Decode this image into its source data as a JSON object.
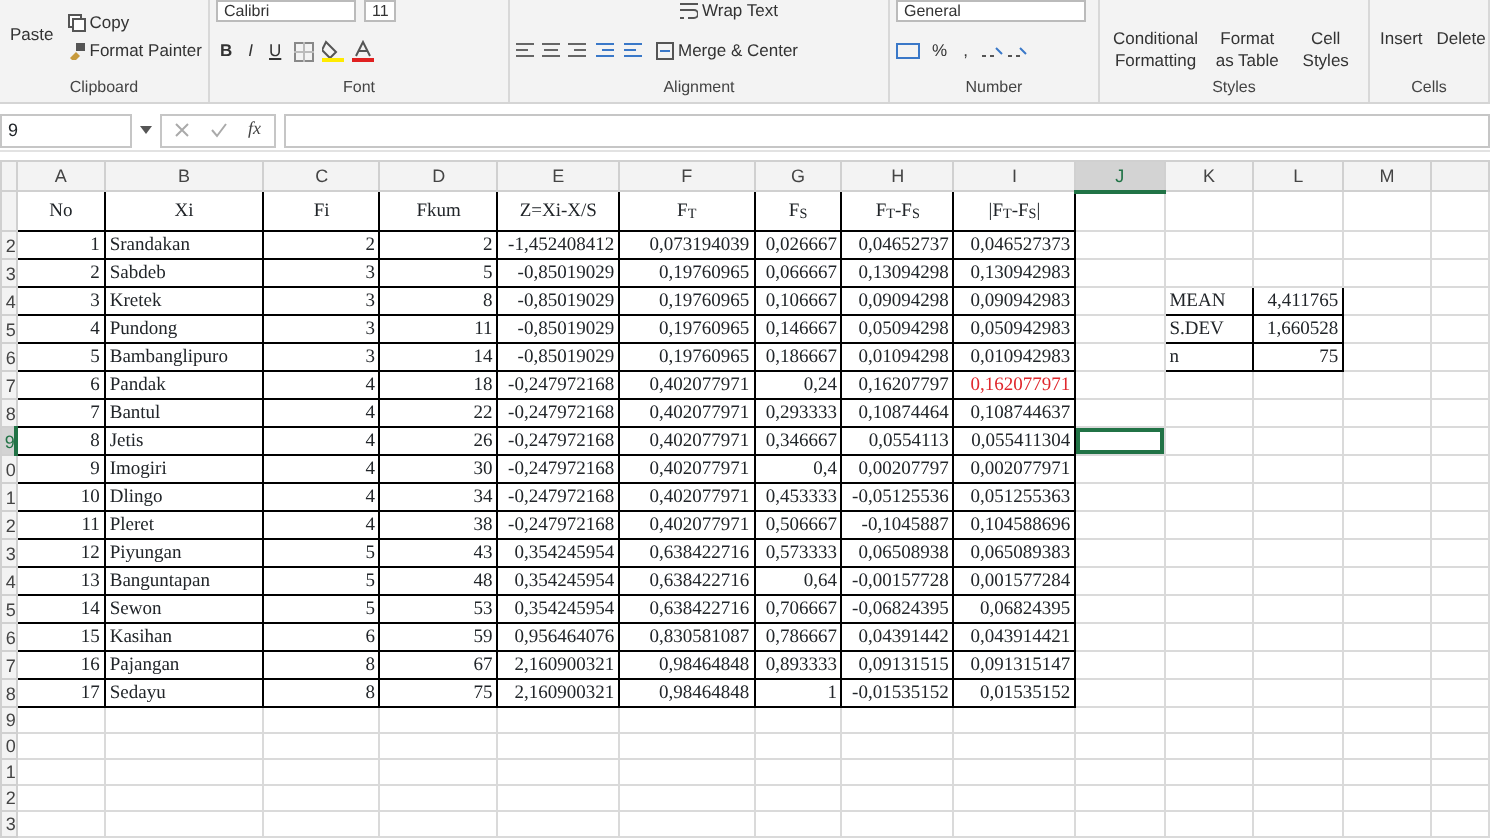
{
  "ribbon": {
    "groups": [
      {
        "label": "Clipboard",
        "kind": "clipboard",
        "items": [
          "Paste",
          "Copy",
          "Format Painter"
        ]
      },
      {
        "label": "Font",
        "kind": "font",
        "items": [
          "Calibri",
          "11",
          "B",
          "I",
          "U"
        ]
      },
      {
        "label": "Alignment",
        "kind": "alignment",
        "items": [
          "Wrap Text",
          "Merge & Center"
        ]
      },
      {
        "label": "Number",
        "kind": "number",
        "items": [
          "General",
          "%",
          ","
        ]
      },
      {
        "label": "Styles",
        "kind": "styles",
        "items": [
          "Conditional Formatting",
          "Format as Table",
          "Cell Styles"
        ]
      },
      {
        "label": "Cells",
        "kind": "cells",
        "items": [
          "Insert",
          "Delete"
        ]
      }
    ]
  },
  "formula_bar": {
    "name_box": "9",
    "function_label": "fx"
  },
  "column_headers": [
    {
      "label": "A",
      "selected": false
    },
    {
      "label": "B",
      "selected": false
    },
    {
      "label": "C",
      "selected": false
    },
    {
      "label": "D",
      "selected": false
    },
    {
      "label": "E",
      "selected": false
    },
    {
      "label": "F",
      "selected": false
    },
    {
      "label": "G",
      "selected": false
    },
    {
      "label": "H",
      "selected": false
    },
    {
      "label": "I",
      "selected": false
    },
    {
      "label": "J",
      "selected": true
    },
    {
      "label": "K",
      "selected": false
    },
    {
      "label": "L",
      "selected": false
    },
    {
      "label": "M",
      "selected": false
    }
  ],
  "row_headers": [
    {
      "label": "2",
      "selected": false
    },
    {
      "label": "3",
      "selected": false
    },
    {
      "label": "4",
      "selected": false
    },
    {
      "label": "5",
      "selected": false
    },
    {
      "label": "6",
      "selected": false
    },
    {
      "label": "7",
      "selected": false
    },
    {
      "label": "8",
      "selected": false
    },
    {
      "label": "9",
      "selected": true
    },
    {
      "label": "0",
      "selected": false
    },
    {
      "label": "1",
      "selected": false
    },
    {
      "label": "2",
      "selected": false
    },
    {
      "label": "3",
      "selected": false
    },
    {
      "label": "4",
      "selected": false
    },
    {
      "label": "5",
      "selected": false
    },
    {
      "label": "6",
      "selected": false
    },
    {
      "label": "7",
      "selected": false
    },
    {
      "label": "8",
      "selected": false
    },
    {
      "label": "9",
      "selected": false
    },
    {
      "label": "0",
      "selected": false
    },
    {
      "label": "1",
      "selected": false
    },
    {
      "label": "2",
      "selected": false
    },
    {
      "label": "3",
      "selected": false
    }
  ],
  "table": {
    "columns": [
      "No",
      "Xi",
      "Fi",
      "Fkum",
      "Z=Xi-X/S",
      "F$_{T}$",
      "F$_{S}$",
      "F$_{T}$-F$_{S}$",
      "|F$_{T}$-F$_{S}$|"
    ],
    "rows": [
      {
        "cells": [
          "1",
          "Srandakan",
          "2",
          "2",
          "-1,452408412",
          "0,073194039",
          "0,026667",
          "0,04652737",
          "0,046527373"
        ],
        "flagged": false
      },
      {
        "cells": [
          "2",
          "Sabdeb",
          "3",
          "5",
          "-0,85019029",
          "0,19760965",
          "0,066667",
          "0,13094298",
          "0,130942983"
        ],
        "flagged": false
      },
      {
        "cells": [
          "3",
          "Kretek",
          "3",
          "8",
          "-0,85019029",
          "0,19760965",
          "0,106667",
          "0,09094298",
          "0,090942983"
        ],
        "flagged": false
      },
      {
        "cells": [
          "4",
          "Pundong",
          "3",
          "11",
          "-0,85019029",
          "0,19760965",
          "0,146667",
          "0,05094298",
          "0,050942983"
        ],
        "flagged": false
      },
      {
        "cells": [
          "5",
          "Bambanglipuro",
          "3",
          "14",
          "-0,85019029",
          "0,19760965",
          "0,186667",
          "0,01094298",
          "0,010942983"
        ],
        "flagged": false
      },
      {
        "cells": [
          "6",
          "Pandak",
          "4",
          "18",
          "-0,247972168",
          "0,402077971",
          "0,24",
          "0,16207797",
          "0,162077971"
        ],
        "flagged": true
      },
      {
        "cells": [
          "7",
          "Bantul",
          "4",
          "22",
          "-0,247972168",
          "0,402077971",
          "0,293333",
          "0,10874464",
          "0,108744637"
        ],
        "flagged": false
      },
      {
        "cells": [
          "8",
          "Jetis",
          "4",
          "26",
          "-0,247972168",
          "0,402077971",
          "0,346667",
          "0,0554113",
          "0,055411304"
        ],
        "flagged": false
      },
      {
        "cells": [
          "9",
          "Imogiri",
          "4",
          "30",
          "-0,247972168",
          "0,402077971",
          "0,4",
          "0,00207797",
          "0,002077971"
        ],
        "flagged": false
      },
      {
        "cells": [
          "10",
          "Dlingo",
          "4",
          "34",
          "-0,247972168",
          "0,402077971",
          "0,453333",
          "-0,05125536",
          "0,051255363"
        ],
        "flagged": false
      },
      {
        "cells": [
          "11",
          "Pleret",
          "4",
          "38",
          "-0,247972168",
          "0,402077971",
          "0,506667",
          "-0,1045887",
          "0,104588696"
        ],
        "flagged": false
      },
      {
        "cells": [
          "12",
          "Piyungan",
          "5",
          "43",
          "0,354245954",
          "0,638422716",
          "0,573333",
          "0,06508938",
          "0,065089383"
        ],
        "flagged": false
      },
      {
        "cells": [
          "13",
          "Banguntapan",
          "5",
          "48",
          "0,354245954",
          "0,638422716",
          "0,64",
          "-0,00157728",
          "0,001577284"
        ],
        "flagged": false
      },
      {
        "cells": [
          "14",
          "Sewon",
          "5",
          "53",
          "0,354245954",
          "0,638422716",
          "0,706667",
          "-0,06824395",
          "0,06824395"
        ],
        "flagged": false
      },
      {
        "cells": [
          "15",
          "Kasihan",
          "6",
          "59",
          "0,956464076",
          "0,830581087",
          "0,786667",
          "0,04391442",
          "0,043914421"
        ],
        "flagged": false
      },
      {
        "cells": [
          "16",
          "Pajangan",
          "8",
          "67",
          "2,160900321",
          "0,98464848",
          "0,893333",
          "0,09131515",
          "0,091315147"
        ],
        "flagged": false
      },
      {
        "cells": [
          "17",
          "Sedayu",
          "8",
          "75",
          "2,160900321",
          "0,98464848",
          "1",
          "-0,01535152",
          "0,01535152"
        ],
        "flagged": false
      }
    ]
  },
  "stats": [
    {
      "label": "MEAN",
      "value": "4,411765"
    },
    {
      "label": "S.DEV",
      "value": "1,660528"
    },
    {
      "label": "n",
      "value": "75"
    }
  ]
}
